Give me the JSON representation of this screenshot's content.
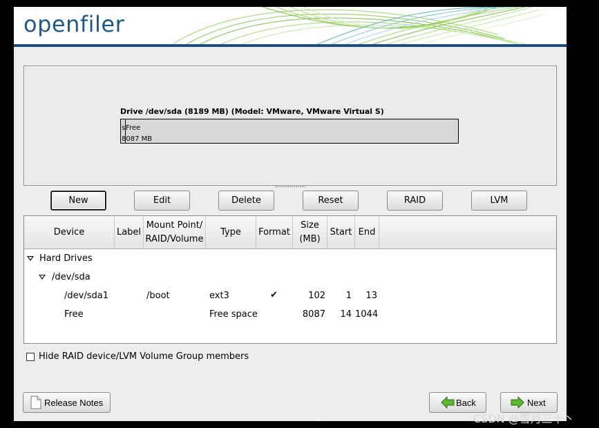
{
  "window": {
    "logo_text": "openfiler"
  },
  "drive_panel": {
    "title": "Drive /dev/sda (8189 MB) (Model: VMware, VMware Virtual S)",
    "small_segment_label": "s",
    "free_label": "Free",
    "free_size": "8087 MB"
  },
  "toolbar": {
    "new_label": "New",
    "edit_label": "Edit",
    "delete_label": "Delete",
    "reset_label": "Reset",
    "raid_label": "RAID",
    "lvm_label": "LVM"
  },
  "table": {
    "headers": {
      "device": "Device",
      "label": "Label",
      "mount_1": "Mount Point/",
      "mount_2": "RAID/Volume",
      "type": "Type",
      "format": "Format",
      "size_1": "Size",
      "size_2": "(MB)",
      "start": "Start",
      "end": "End"
    },
    "group_label": "Hard Drives",
    "drive_label": "/dev/sda",
    "rows": [
      {
        "device": "/dev/sda1",
        "mount": "/boot",
        "type": "ext3",
        "format": "✔",
        "size": "102",
        "start": "1",
        "end": "13"
      },
      {
        "device": "Free",
        "mount": "",
        "type": "Free space",
        "format": "",
        "size": "8087",
        "start": "14",
        "end": "1044"
      }
    ]
  },
  "hide_members": {
    "label": "Hide RAID device/LVM Volume Group members",
    "checked": false
  },
  "footer": {
    "release_notes_label": "Release Notes",
    "back_label": "Back",
    "next_label": "Next"
  },
  "watermark": "CSDN @雪月三十丶",
  "colors": {
    "brand_blue": "#1c4f7b",
    "banner_green": "#7cc142",
    "background": "#ededed"
  }
}
